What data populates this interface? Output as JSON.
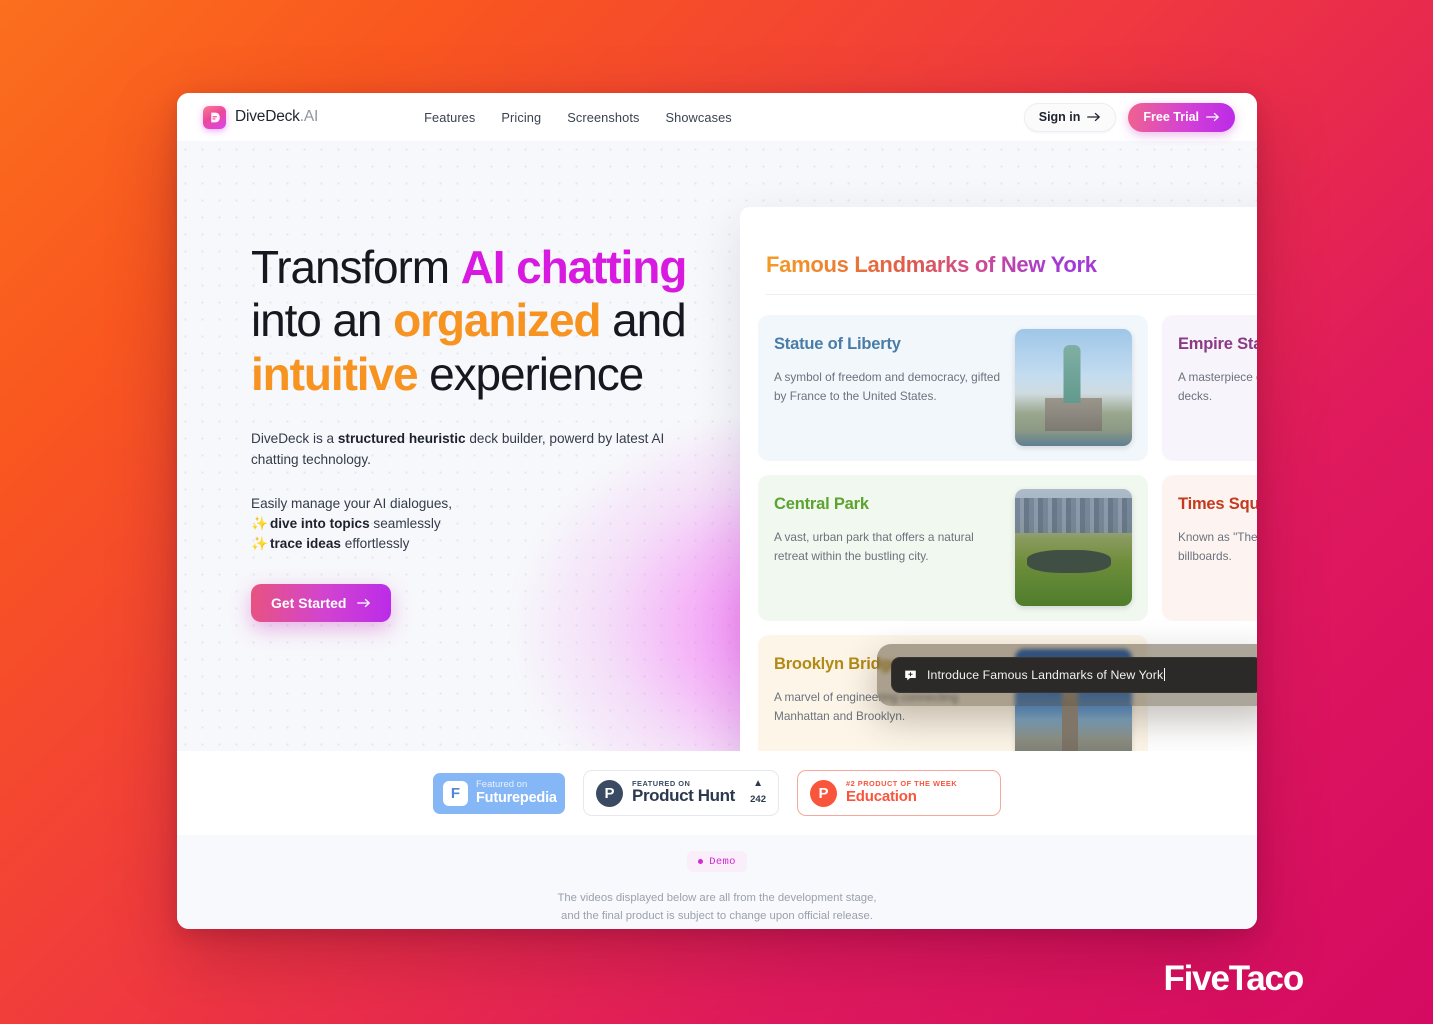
{
  "nav": {
    "brand_name": "DiveDeck",
    "brand_suffix": ".AI",
    "links": [
      {
        "label": "Features"
      },
      {
        "label": "Pricing"
      },
      {
        "label": "Screenshots"
      },
      {
        "label": "Showcases"
      }
    ],
    "sign_in": "Sign in",
    "free_trial": "Free Trial"
  },
  "hero": {
    "headline": {
      "l1_a": "Transform ",
      "l1_b": "AI chatting",
      "l2_a": "into an ",
      "l2_b": "organized",
      "l2_c": " and",
      "l3_a": "intuitive",
      "l3_b": " experience"
    },
    "lead_a": "DiveDeck is a ",
    "lead_b": "structured heuristic",
    "lead_c": " deck builder, powerd by latest AI chatting technology.",
    "bullets_intro": "Easily manage your AI dialogues,",
    "bullet1_b": "dive into topics",
    "bullet1_rest": " seamlessly",
    "bullet2_b": "trace ideas",
    "bullet2_rest": " effortlessly",
    "cta": "Get Started",
    "colors": {
      "magenta": "#d81ae0",
      "orange": "#f79321"
    }
  },
  "preview": {
    "title": "Famous Landmarks of New York",
    "cards": [
      {
        "title": "Statue of Liberty",
        "desc": "A symbol of freedom and democracy, gifted by France to the United States."
      },
      {
        "title": "Empire State Building",
        "desc": "A masterpiece of art deco, known for its height and observation decks."
      },
      {
        "title": "Central Park",
        "desc": "A vast, urban park that offers a natural retreat within the bustling city."
      },
      {
        "title": "Times Square",
        "desc": "Known as \"The Crossroads of the World\" for its vibrant lights and billboards."
      },
      {
        "title": "Brooklyn Bridge",
        "desc": "A marvel of engineering connecting Manhattan and Brooklyn."
      }
    ],
    "command_input": "Introduce Famous Landmarks of New York"
  },
  "badges": {
    "futurepedia": {
      "small": "Featured on",
      "big": "Futurepedia",
      "mark": "F"
    },
    "product_hunt": {
      "small": "FEATURED ON",
      "big": "Product Hunt",
      "mark": "P",
      "votes": "242",
      "triangle": "▲"
    },
    "education": {
      "small": "#2 PRODUCT OF THE WEEK",
      "big": "Education",
      "mark": "P"
    }
  },
  "demo": {
    "pill": "Demo",
    "note_line1": "The videos displayed below are all from the development stage,",
    "note_line2": "and the final product is subject to change upon official release."
  },
  "watermark": "FiveTaco"
}
